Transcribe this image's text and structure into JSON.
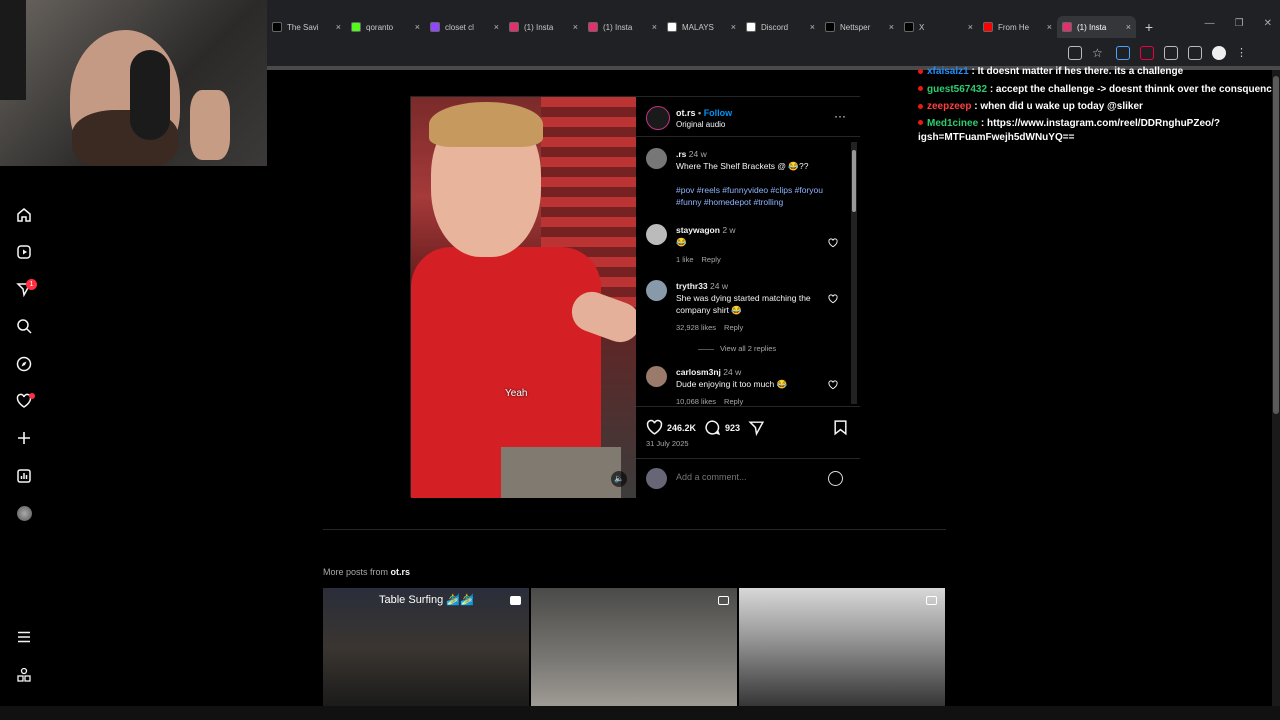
{
  "browser": {
    "tabs": [
      {
        "label": "The Savi",
        "icon": "x-icon",
        "color": "#000000"
      },
      {
        "label": "qoranto",
        "icon": "kick-icon",
        "color": "#53fc18"
      },
      {
        "label": "closet cl",
        "icon": "twitch-icon",
        "color": "#9146ff"
      },
      {
        "label": "(1) Insta",
        "icon": "instagram-icon",
        "color": "#e1306c"
      },
      {
        "label": "(1) Insta",
        "icon": "instagram-icon",
        "color": "#e1306c"
      },
      {
        "label": "MALAYS",
        "icon": "google-icon",
        "color": "#ffffff"
      },
      {
        "label": "Discord",
        "icon": "discord-icon",
        "color": "#ffffff"
      },
      {
        "label": "Nettsper",
        "icon": "x-icon",
        "color": "#000000"
      },
      {
        "label": "X",
        "icon": "x-icon",
        "color": "#000000"
      },
      {
        "label": "From He",
        "icon": "youtube-icon",
        "color": "#ff0000"
      },
      {
        "label": "(1) Insta",
        "icon": "instagram-icon",
        "color": "#e1306c"
      }
    ],
    "close_glyph": "×",
    "new_tab": "+"
  },
  "sidebar": {
    "notifications_badge": "1"
  },
  "post": {
    "username": "ot.rs",
    "follow": "Follow",
    "audio": "Original audio",
    "video_caption": "Yeah",
    "likes": "246.2K",
    "comments_count": "923",
    "date": "31 July 2025",
    "add_comment_placeholder": "Add a comment...",
    "caption": {
      "user": ".rs",
      "time": "24 w",
      "text": "Where The Shelf Brackets @ 😂??",
      "hashtags": "#pov #reels #funnyvideo #clips #foryou #funny #homedepot #trolling"
    },
    "comments": [
      {
        "user": "staywagon",
        "time": "2 w",
        "text": "😂",
        "likes": "1 like",
        "reply": "Reply"
      },
      {
        "user": "trythr33",
        "time": "24 w",
        "text": "She was dying started matching the company shirt 😂",
        "likes": "32,928 likes",
        "reply": "Reply",
        "view_replies": "View all 2 replies"
      },
      {
        "user": "carlosm3nj",
        "time": "24 w",
        "text": "Dude enjoying it too much 😂",
        "likes": "10,068 likes",
        "reply": "Reply"
      }
    ]
  },
  "more_posts": {
    "label": "More posts from",
    "user": "ot.rs",
    "thumbs": [
      {
        "title": "Table Surfing 🏄‍♂️🏄‍♂️"
      },
      {
        "title": ""
      },
      {
        "title": ""
      }
    ]
  },
  "chat": [
    {
      "user": "xfaisalz1",
      "color": "#1e90ff",
      "text": ": It doesnt matter if hes there. its a challenge"
    },
    {
      "user": "guest567432",
      "color": "#2ecc71",
      "text": ": accept the challenge -> doesnt thinnk over the consquences"
    },
    {
      "user": "zeepzeep",
      "color": "#ff4040",
      "text": ": when did u wake up today @sliker"
    },
    {
      "user": "Med1cinee",
      "color": "#2ecc71",
      "text": ": https://www.instagram.com/reel/DDRnghuPZeo/?igsh=MTFuamFwejh5dWNuYQ=="
    }
  ]
}
